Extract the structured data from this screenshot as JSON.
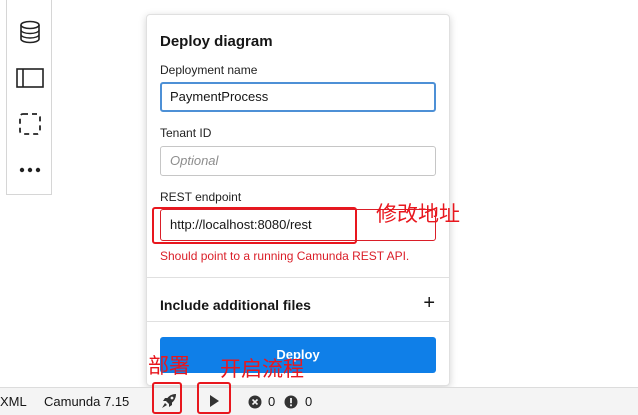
{
  "toolbar": {
    "tools": [
      {
        "icon": "database-icon"
      },
      {
        "icon": "pool-icon"
      },
      {
        "icon": "group-icon"
      },
      {
        "icon": "more-icon"
      }
    ]
  },
  "panel": {
    "title": "Deploy diagram",
    "deployment_name": {
      "label": "Deployment name",
      "value": "PaymentProcess"
    },
    "tenant_id": {
      "label": "Tenant ID",
      "placeholder": "Optional"
    },
    "rest_endpoint": {
      "label": "REST endpoint",
      "value": "http://localhost:8080/rest",
      "error": "Should point to a running Camunda REST API."
    },
    "additional_files": {
      "label": "Include additional files",
      "expand_icon": "plus-icon"
    },
    "deploy_label": "Deploy"
  },
  "annotations": {
    "endpoint_note": "修改地址",
    "deploy_note": "部署",
    "start_note": "开启流程",
    "color": "#e8171e"
  },
  "statusbar": {
    "xml_label": "XML",
    "engine": "Camunda 7.15",
    "deploy_icon": "rocket-icon",
    "run_icon": "play-icon",
    "errors": "0",
    "warnings": "0"
  },
  "colors": {
    "accent": "#0f7fe8",
    "error": "#da1e28",
    "focus": "#4d90d6"
  }
}
